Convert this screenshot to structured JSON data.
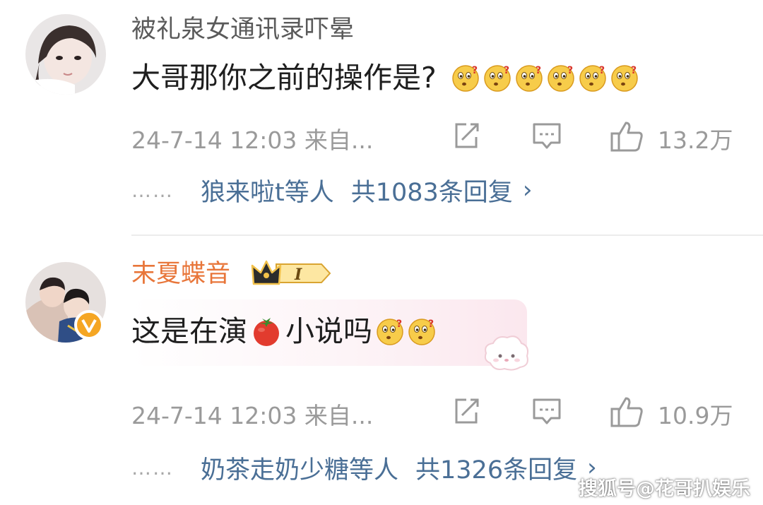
{
  "comments": [
    {
      "username": "被礼泉女通讯录吓晕",
      "text": "大哥那你之前的操作是?",
      "emoji_icon": "confused-face-icon",
      "emoji_count": 6,
      "time": "24-7-14 12:03 来自...",
      "likes": "13.2万",
      "reply_names": "狼来啦t等人",
      "reply_total": "共1083条回复"
    },
    {
      "username": "末夏蝶音",
      "badge": "I",
      "text_before": "这是在演",
      "text_icon": "tomato-icon",
      "text_after": "小说吗",
      "emoji_icon": "confused-face-icon",
      "emoji_count": 2,
      "time": "24-7-14 12:03 来自...",
      "likes": "10.9万",
      "reply_names": "奶茶走奶少糖等人",
      "reply_total": "共1326条回复",
      "verified": true
    }
  ],
  "reply_dots": "……",
  "reply_chevron": "›",
  "watermark": "搜狐号@花哥扒娱乐",
  "colors": {
    "username_gray": "#5a5a5a",
    "username_orange": "#e8763a",
    "meta_gray": "#9a9a9a",
    "link_blue": "#4a6f96"
  }
}
